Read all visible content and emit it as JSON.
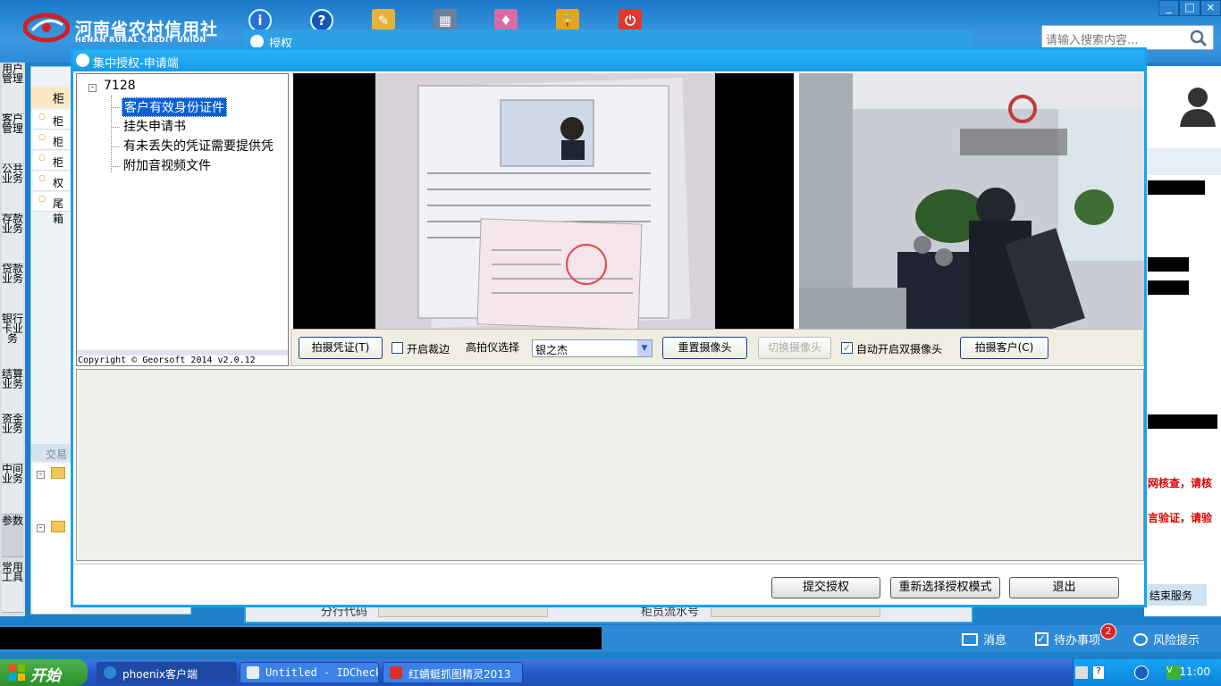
{
  "app": {
    "logo_cn": "河南省农村信用社",
    "logo_en": "HENAN RURAL CREDIT UNION",
    "search_placeholder": "请输入搜索内容...",
    "toolbar_icons": [
      "info-icon",
      "help-icon",
      "tools-icon",
      "calculator-icon",
      "skin-icon",
      "lock-icon",
      "power-icon"
    ],
    "window_buttons": [
      "_",
      "□",
      "×"
    ]
  },
  "left_nav": {
    "items": [
      "用户管理",
      "客户管理",
      "公共业务",
      "存款业务",
      "贷款业务",
      "银行卡业务",
      "结算业务",
      "资金业务",
      "中间业务",
      "参数",
      "常用工具"
    ]
  },
  "bg_left_panel": {
    "header": "柜",
    "rows": [
      "柜员",
      "柜员",
      "柜员",
      "权限",
      "尾箱"
    ],
    "section": "交易"
  },
  "bg_window": {
    "title": "授权",
    "field1_label": "分行代码",
    "field2_label": "柜员流水号"
  },
  "bg_right": {
    "red_line1": "网核查，请核",
    "red_line2": "言验证，请验",
    "end_service": "结束服务"
  },
  "dialog": {
    "title": "集中授权-申请端",
    "tree": {
      "root": "7128",
      "items": [
        "客户有效身份证件",
        "挂失申请书",
        "有未丢失的凭证需要提供凭",
        "附加音视频文件"
      ],
      "selected_index": 0
    },
    "copyright": "Copyright © Georsoft 2014 v2.0.12",
    "controls": {
      "capture_voucher": "拍摄凭证(T)",
      "crop_label": "开启裁边",
      "crop_checked": false,
      "scanner_label": "高拍仪选择",
      "scanner_value": "银之杰",
      "reset_camera": "重置摄像头",
      "switch_camera": "切换摄像头",
      "auto_dual_label": "自动开启双摄像头",
      "auto_dual_checked": true,
      "capture_customer": "拍摄客户(C)"
    },
    "footer": {
      "submit": "提交授权",
      "reselect": "重新选择授权模式",
      "exit": "退出"
    }
  },
  "statusbar": {
    "messages": "消息",
    "todo": "待办事项",
    "todo_count": "2",
    "risk": "风险提示"
  },
  "taskbar": {
    "start": "开始",
    "tasks": [
      "phoenix客户端",
      "Untitled - IDCheck",
      "红蜻蜓抓图精灵2013"
    ],
    "clock": "11:00"
  }
}
